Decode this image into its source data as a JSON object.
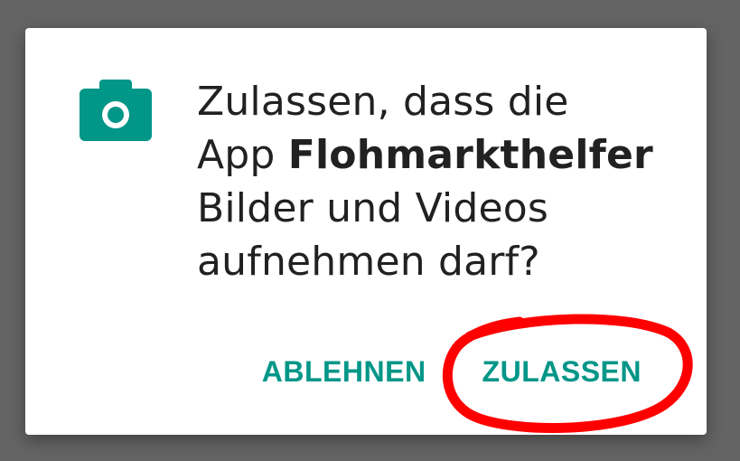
{
  "dialog": {
    "message_line1": "Zulassen, dass die",
    "message_line2_prefix": "App ",
    "app_name": "Flohmarkthelfer",
    "message_line3": "Bilder und Videos",
    "message_line4": "aufnehmen darf?",
    "icon": "camera-icon",
    "deny_label": "ABLEHNEN",
    "allow_label": "ZULASSEN"
  },
  "colors": {
    "accent": "#009688",
    "annotation": "#ff0000"
  }
}
